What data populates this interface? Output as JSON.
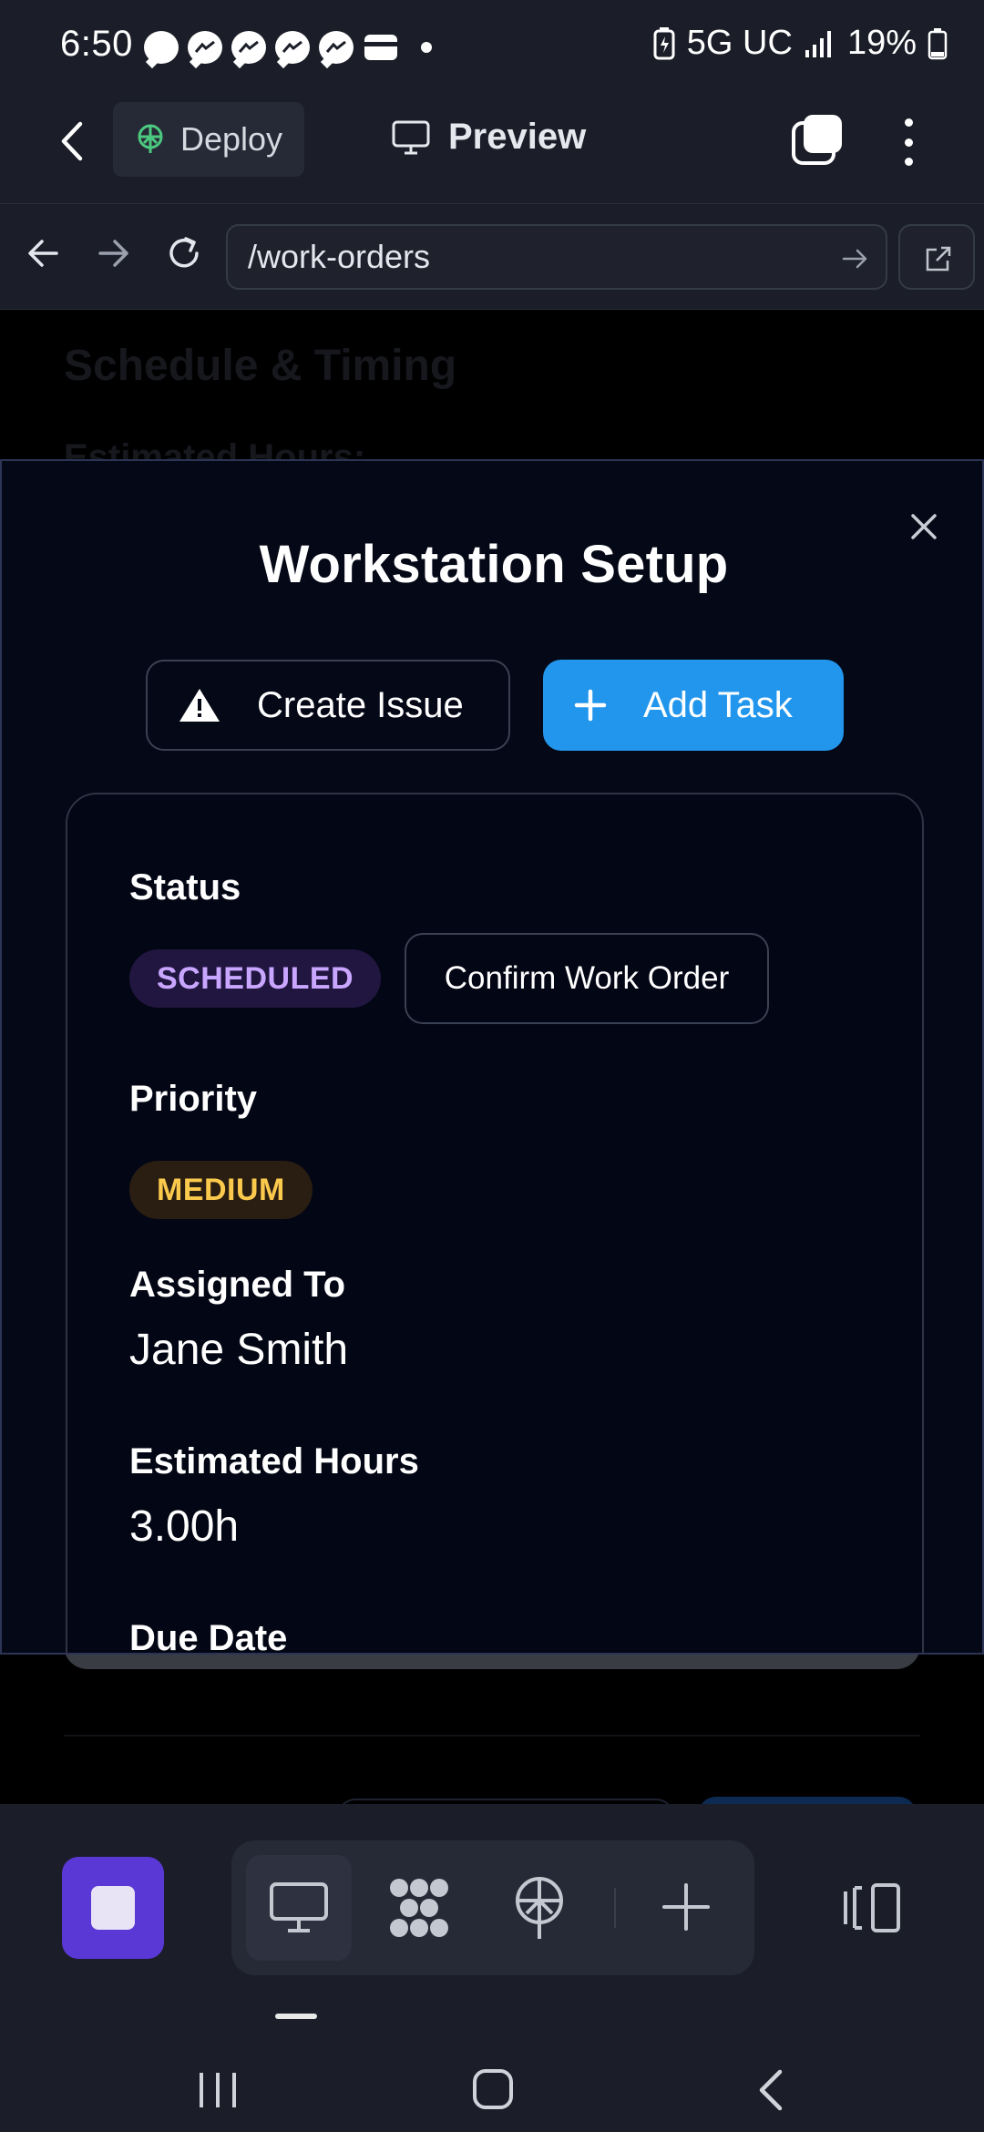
{
  "status_bar": {
    "time": "6:50",
    "network": "5G UC",
    "battery": "19%",
    "notification_icons": [
      "chat-bubble-icon",
      "messenger-icon",
      "messenger-icon",
      "messenger-icon",
      "messenger-icon",
      "wallet-icon",
      "dot-icon"
    ]
  },
  "app_bar": {
    "deploy_label": "Deploy",
    "preview_label": "Preview"
  },
  "browser": {
    "url": "/work-orders"
  },
  "background_page": {
    "heading": "Schedule & Timing",
    "subheading": "Estimated Hours:"
  },
  "modal": {
    "title": "Workstation Setup",
    "create_issue_label": "Create Issue",
    "add_task_label": "Add Task",
    "fields": {
      "status_label": "Status",
      "status_value": "SCHEDULED",
      "confirm_label": "Confirm Work Order",
      "priority_label": "Priority",
      "priority_value": "MEDIUM",
      "assigned_label": "Assigned To",
      "assigned_value": "Jane Smith",
      "hours_label": "Estimated Hours",
      "hours_value": "3.00h",
      "due_label": "Due Date"
    }
  },
  "colors": {
    "accent_blue": "#2296ec",
    "stop_purple": "#5a38d6",
    "status_purple": "#c9a6ff",
    "priority_yellow": "#fbc94c"
  }
}
